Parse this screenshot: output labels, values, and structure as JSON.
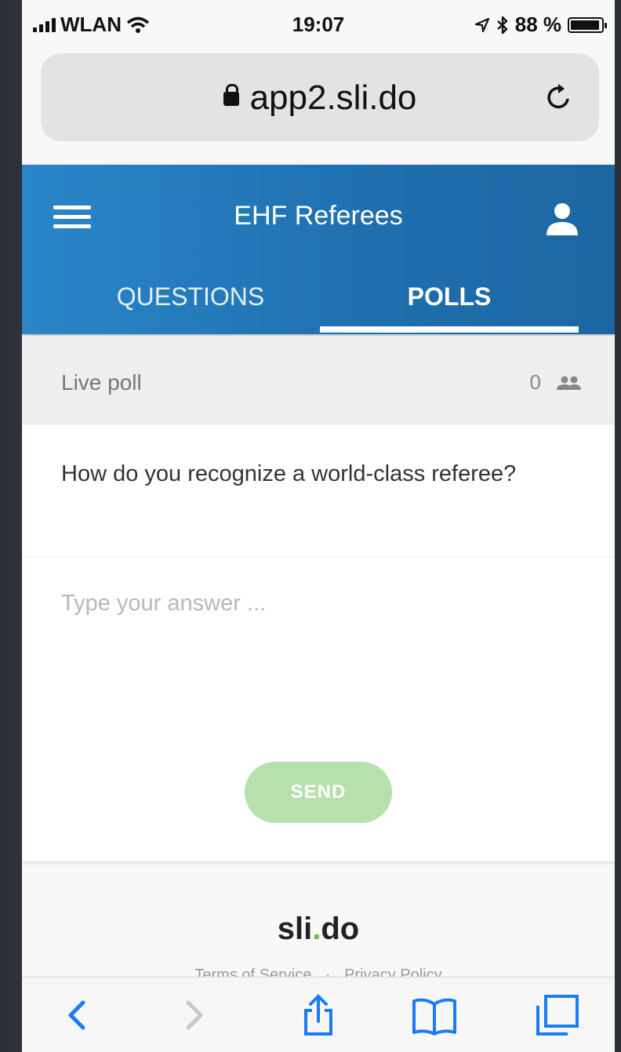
{
  "status_bar": {
    "carrier": "WLAN",
    "time": "19:07",
    "battery": "88 %",
    "icons": [
      "signal-icon",
      "wifi-icon",
      "location-icon",
      "bluetooth-icon",
      "battery-icon"
    ]
  },
  "browser": {
    "url": "app2.sli.do",
    "icons": [
      "lock-icon",
      "reload-icon"
    ]
  },
  "app_header": {
    "title": "EHF Referees",
    "tabs": [
      {
        "label": "QUESTIONS",
        "active": false
      },
      {
        "label": "POLLS",
        "active": true
      }
    ],
    "icons": [
      "hamburger-menu-icon",
      "user-icon"
    ]
  },
  "poll": {
    "status_label": "Live poll",
    "participant_count": "0",
    "question": "How do you recognize a world-class referee?",
    "answer_placeholder": "Type your answer ...",
    "send_label": "SEND"
  },
  "footer": {
    "logo_main": "sli",
    "logo_dot": ".",
    "logo_end": "do",
    "links": [
      "Terms of Service",
      "Privacy Policy"
    ],
    "separator": "·"
  },
  "toolbar": {
    "icons": [
      "back-icon",
      "forward-icon",
      "share-icon",
      "bookmarks-icon",
      "tabs-icon"
    ]
  },
  "colors": {
    "header_blue": "#2277b8",
    "send_green": "#b8e0ad",
    "ios_blue": "#1a7cf5"
  }
}
